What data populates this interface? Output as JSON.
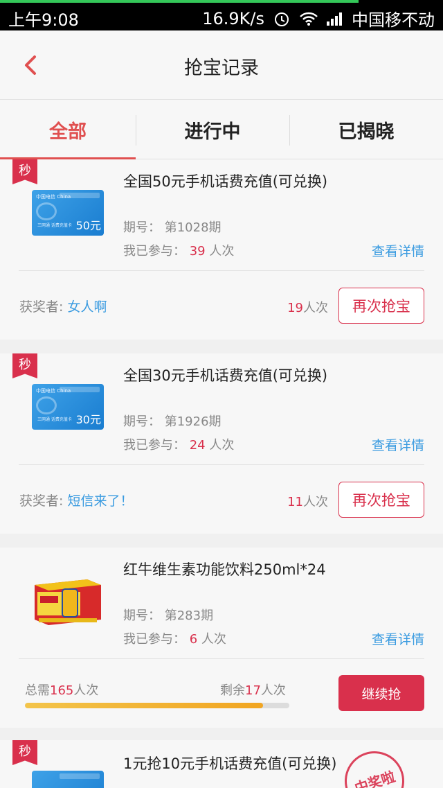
{
  "status_bar": {
    "time": "上午9:08",
    "speed": "16.9K/s",
    "carrier": "中国移不动"
  },
  "header": {
    "title": "抢宝记录"
  },
  "tabs": [
    {
      "label": "全部",
      "active": true
    },
    {
      "label": "进行中",
      "active": false
    },
    {
      "label": "已揭晓",
      "active": false
    }
  ],
  "labels": {
    "seckill": "秒",
    "period_prefix": "期号：",
    "joined_prefix": "我已参与：",
    "times_unit": "人次",
    "view_details": "查看详情",
    "winner_prefix": "获奖者:",
    "again_button": "再次抢宝",
    "continue_button": "继续抢",
    "need_prefix": "总需",
    "remain_prefix": "剩余",
    "stamp": "中奖啦"
  },
  "records": [
    {
      "name": "全国50元手机话费充值(可兑换)",
      "period": "第1028期",
      "joined": "39",
      "winner": "女人啊",
      "winner_times": "19",
      "card_amount": "50元",
      "card_title": "中国电信 China",
      "card_sub": "三网通 话费充值卡"
    },
    {
      "name": "全国30元手机话费充值(可兑换)",
      "period": "第1926期",
      "joined": "24",
      "winner": "短信来了！",
      "winner_times": "11",
      "card_amount": "30元",
      "card_title": "中国电信 China",
      "card_sub": "三网通 话费充值卡"
    },
    {
      "name": "红牛维生素功能饮料250ml*24",
      "period": "第283期",
      "joined": "6",
      "need": "165",
      "remain": "17",
      "progress": 0.9
    },
    {
      "name": "1元抢10元手机话费充值(可兑换)"
    }
  ],
  "colors": {
    "accent": "#d9304c",
    "link": "#3a9be0",
    "tab_active": "#e05050"
  }
}
